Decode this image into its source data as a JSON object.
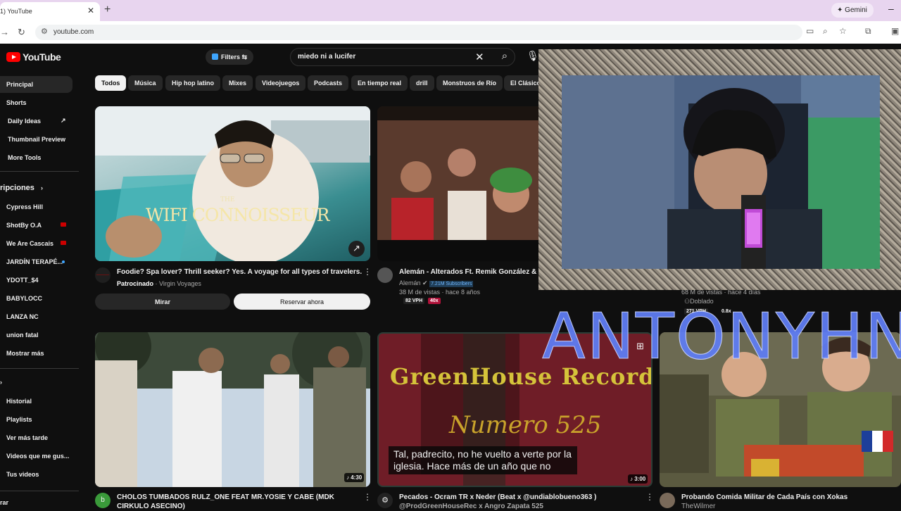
{
  "browser": {
    "tab_title": "1) YouTube",
    "url": "youtube.com",
    "gemini_label": "Gemini"
  },
  "youtube": {
    "logo_text": "YouTube",
    "filters_label": "Filters",
    "search_query": "miedo ni a lucifer",
    "sidebar": {
      "top_items": [
        {
          "label": "Principal"
        },
        {
          "label": "Shorts"
        },
        {
          "label": "Daily Ideas"
        },
        {
          "label": "Thumbnail Preview"
        },
        {
          "label": "More Tools"
        }
      ],
      "subs_header": "ripciones",
      "subscriptions": [
        {
          "label": "Cypress Hill"
        },
        {
          "label": "ShotBy O.A"
        },
        {
          "label": "We Are Cascais"
        },
        {
          "label": "JARDÍN TERAPÉ..."
        },
        {
          "label": "YDOTT_$4"
        },
        {
          "label": "BABYLOCC"
        },
        {
          "label": "LANZA NC"
        },
        {
          "label": "union fatal"
        },
        {
          "label": "Mostrar más"
        }
      ],
      "you_items": [
        {
          "label": "Historial"
        },
        {
          "label": "Playlists"
        },
        {
          "label": "Ver más tarde"
        },
        {
          "label": "Videos que me gus..."
        },
        {
          "label": "Tus videos"
        }
      ],
      "bottom_header": "rar"
    },
    "chips": [
      "Todos",
      "Música",
      "Hip hop latino",
      "Mixes",
      "Videojuegos",
      "Podcasts",
      "En tiempo real",
      "drill",
      "Monstruos de Río",
      "El Clásico"
    ],
    "videos": {
      "ad": {
        "overlay_small": "THE",
        "overlay_big": "WIFI CONNOISSEUR",
        "title": "Foodie? Spa lover? Thrill seeker? Yes. A voyage for all types of travelers.",
        "sponsored": "Patrocinado",
        "advertiser": "Virgin Voyages",
        "btn_watch": "Mirar",
        "btn_book": "Reservar ahora"
      },
      "v2": {
        "title": "Alemán - Alterados Ft. Remik González & E",
        "channel": "Alemán",
        "subs_badge": "7.21M Subscribers",
        "stats": "38 M de vistas · hace 8 años",
        "vph": "82 VPH",
        "mult": "40x"
      },
      "v3": {
        "stats": "68 M de vistas · hace 4 días",
        "dubbed": "Doblado",
        "vph": "271 VPH",
        "mult": "0.8x"
      },
      "v4": {
        "title_line1": "CHOLOS TUMBADOS RULZ_ONE  FEAT MR.YOSIE  Y CABE (MDK",
        "title_line2": "CIRKULO ASECINO)",
        "duration": "4:30",
        "avatar_letter": "b"
      },
      "v5": {
        "header": "GreenHouse Records",
        "subheader": "Numero 525",
        "title": "Pecados - Ocram TR x Neder (Beat x @undiablobueno363 )",
        "title_line2": "@ProdGreenHouseRec x Angro Zapata 525",
        "duration": "3:00",
        "caption": "Tal, padrecito, no he vuelto a verte por la iglesia. Hace más de un año que no"
      },
      "v6": {
        "title": "Probando Comida Militar de Cada País con Xokas",
        "channel": "TheWilmer"
      }
    }
  },
  "stream_overlay": {
    "name": "ANTONYHN"
  },
  "colors": {
    "yt_bg": "#0f0f0f",
    "chip_bg": "#272727",
    "accent_red": "#ff0000",
    "overlay_blue": "#5f7cf2"
  }
}
